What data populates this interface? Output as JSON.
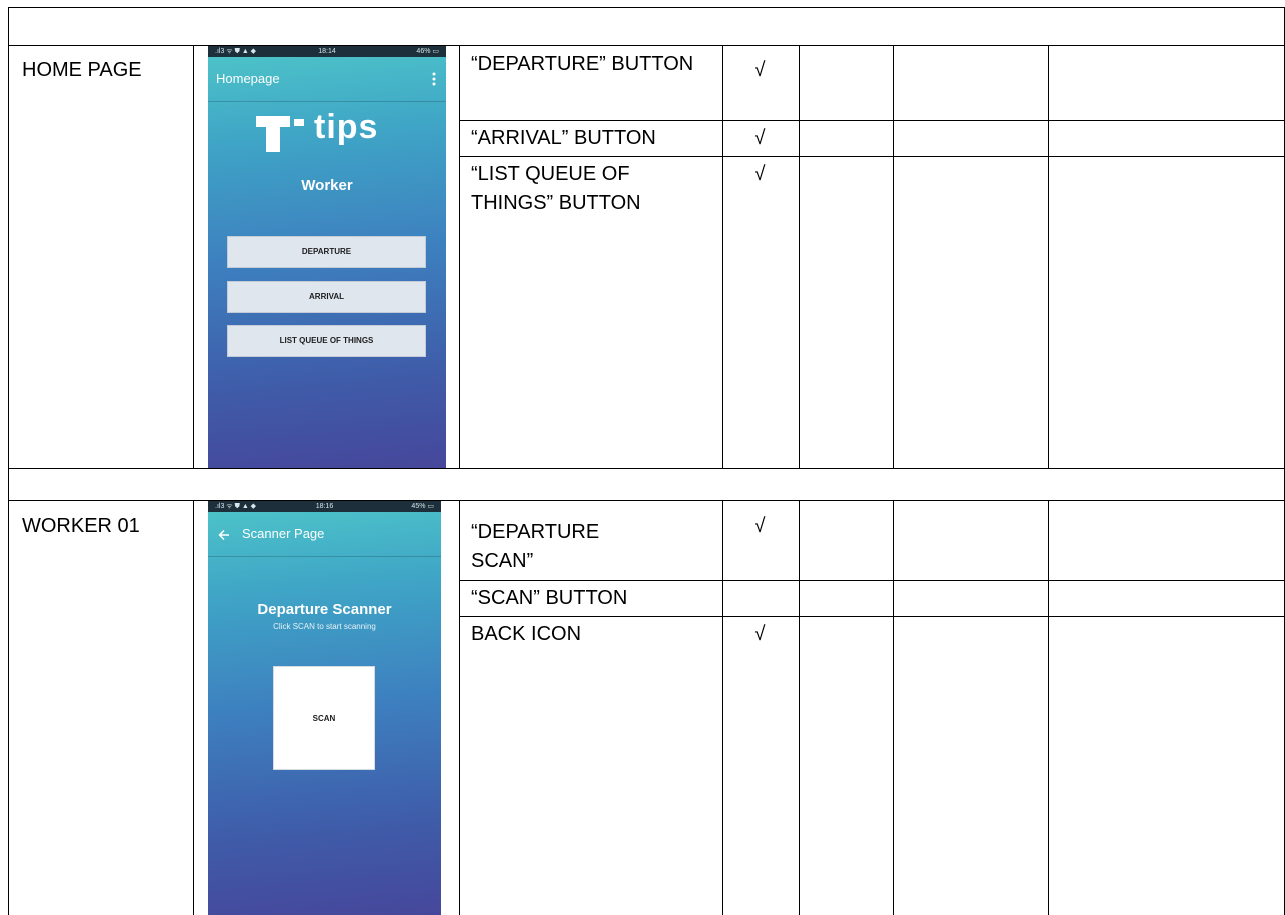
{
  "rows": [
    {
      "page_label": "HOME PAGE",
      "screenshot": {
        "status_left": ".ıl3 ᯤ ⛊ ▲ ◆",
        "status_time": "18:14",
        "status_battery": "46% ▭",
        "appbar_title": "Homepage",
        "menu_icon": "kebab-menu-icon",
        "logo_text": "tips",
        "logo_mark": "T",
        "role_heading": "Worker",
        "buttons": [
          "DEPARTURE",
          "ARRIVAL",
          "LIST QUEUE OF THINGS"
        ]
      },
      "test_items": [
        {
          "description": "“DEPARTURE” BUTTON",
          "pass": "√"
        },
        {
          "description": "“ARRIVAL” BUTTON",
          "pass": "√"
        },
        {
          "description": "“LIST QUEUE OF THINGS” BUTTON",
          "pass": "√"
        }
      ]
    },
    {
      "page_label": "WORKER 01",
      "screenshot": {
        "status_left": ".ıl3 ᯤ ⛊ ▲ ◆",
        "status_time": "18:16",
        "status_battery": "45% ▭",
        "appbar_title": "Scanner Page",
        "back_icon": "back-arrow-icon",
        "heading": "Departure Scanner",
        "subheading": "Click SCAN to start scanning",
        "scan_button": "SCAN"
      },
      "test_items": [
        {
          "description": "“DEPARTURE SCAN”",
          "pass": "√"
        },
        {
          "description": "“SCAN” BUTTON",
          "pass": ""
        },
        {
          "description": "BACK ICON",
          "pass": "√"
        }
      ]
    }
  ],
  "colors": {
    "gradient_top": "#4ec6c9",
    "gradient_bottom": "#46479b",
    "phone_button_bg": "#dfe6ee"
  }
}
